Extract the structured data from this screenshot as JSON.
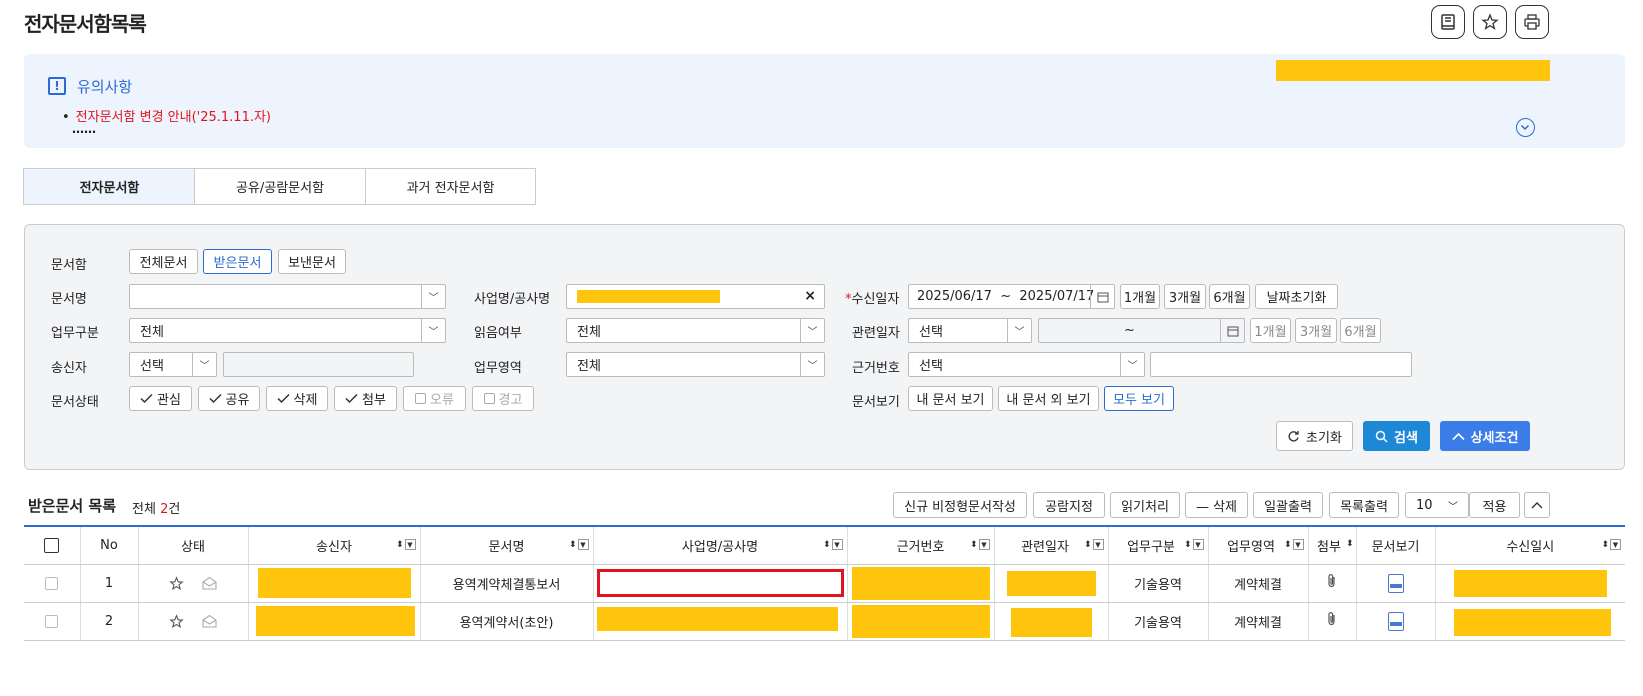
{
  "page": {
    "title": "전자문서함목록"
  },
  "notice": {
    "title": "유의사항",
    "items": [
      "전자문서함 변경 안내('25.1.11.자)"
    ],
    "more": "……"
  },
  "tabs": [
    "전자문서함",
    "공유/공람문서함",
    "과거 전자문서함"
  ],
  "search": {
    "doc_box": {
      "label": "문서함",
      "options": [
        "전체문서",
        "받은문서",
        "보낸문서"
      ]
    },
    "doc_name": {
      "label": "문서명",
      "value": ""
    },
    "project": {
      "label": "사업명/공사명",
      "clear": "×"
    },
    "recv_date": {
      "required": "*",
      "label": "수신일자",
      "from": "2025/06/17",
      "sep": "~",
      "to": "2025/07/17",
      "quick": [
        "1개월",
        "3개월",
        "6개월"
      ],
      "reset": "날짜초기화"
    },
    "work_type": {
      "label": "업무구분",
      "value": "전체"
    },
    "read": {
      "label": "읽음여부",
      "value": "전체"
    },
    "rel_date": {
      "label": "관련일자",
      "value": "선택",
      "sep": "~",
      "quick": [
        "1개월",
        "3개월",
        "6개월"
      ]
    },
    "sender": {
      "label": "송신자",
      "value": "선택",
      "text": ""
    },
    "work_area": {
      "label": "업무영역",
      "value": "전체"
    },
    "basis": {
      "label": "근거번호",
      "value": "선택",
      "text": ""
    },
    "status": {
      "label": "문서상태",
      "checks": [
        {
          "label": "관심",
          "on": true
        },
        {
          "label": "공유",
          "on": true
        },
        {
          "label": "삭제",
          "on": true
        },
        {
          "label": "첨부",
          "on": true
        },
        {
          "label": "오류",
          "on": false
        },
        {
          "label": "경고",
          "on": false
        }
      ]
    },
    "view": {
      "label": "문서보기",
      "options": [
        "내 문서 보기",
        "내 문서 외 보기",
        "모두 보기"
      ]
    },
    "buttons": {
      "reset": "초기화",
      "search": "검색",
      "detail": "상세조건"
    }
  },
  "list": {
    "title": "받은문서 목록",
    "total_prefix": "전체 ",
    "total": "2",
    "total_suffix": "건",
    "actions": [
      "신규 비정형문서작성",
      "공람지정",
      "읽기처리",
      "— 삭제",
      "일괄출력",
      "목록출력"
    ],
    "page_size": "10",
    "apply": "적용",
    "columns": [
      "No",
      "상태",
      "송신자",
      "문서명",
      "사업명/공사명",
      "근거번호",
      "관련일자",
      "업무구분",
      "업무영역",
      "첨부",
      "문서보기",
      "수신일시"
    ],
    "rows": [
      {
        "no": "1",
        "doc": "용역계약체결통보서",
        "work_type": "기술용역",
        "work_area": "계약체결"
      },
      {
        "no": "2",
        "doc": "용역계약서(초안)",
        "work_type": "기술용역",
        "work_area": "계약체결"
      }
    ]
  },
  "colors": {
    "accent": "#2d6bd3",
    "primary_button": "#1e88d6",
    "detail_button": "#3b7de8",
    "alert": "#e0151c",
    "redaction": "#ffc50c"
  }
}
